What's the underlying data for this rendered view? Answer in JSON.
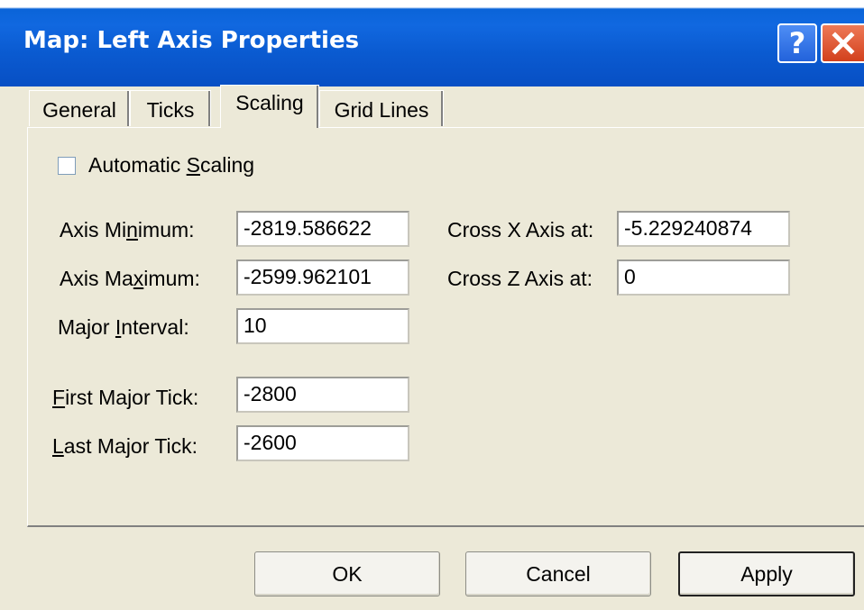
{
  "window": {
    "title": "Map: Left Axis Properties",
    "help_glyph": "?",
    "help_icon": "help-icon",
    "close_icon": "close-icon"
  },
  "tabs": [
    {
      "label": "General",
      "active": false
    },
    {
      "label": "Ticks",
      "active": false
    },
    {
      "label": "Scaling",
      "active": true
    },
    {
      "label": "Grid Lines",
      "active": false
    }
  ],
  "scaling": {
    "automatic_scaling": {
      "label_pre": "Automatic ",
      "label_accel": "S",
      "label_post": "caling",
      "checked": false
    },
    "axis_minimum": {
      "label_pre": "Axis Mi",
      "label_accel": "n",
      "label_post": "imum:",
      "value": "-2819.586622"
    },
    "axis_maximum": {
      "label_pre": "Axis Ma",
      "label_accel": "x",
      "label_post": "imum:",
      "value": "-2599.962101"
    },
    "major_interval": {
      "label_pre": "Major ",
      "label_accel": "I",
      "label_post": "nterval:",
      "value": "10"
    },
    "first_major_tick": {
      "label_pre": "",
      "label_accel": "F",
      "label_post": "irst Major Tick:",
      "value": "-2800"
    },
    "last_major_tick": {
      "label_pre": "",
      "label_accel": "L",
      "label_post": "ast Major Tick:",
      "value": "-2600"
    },
    "cross_x_axis": {
      "label": "Cross X Axis at:",
      "value": "-5.229240874"
    },
    "cross_z_axis": {
      "label": "Cross Z Axis at:",
      "value": "0"
    }
  },
  "buttons": {
    "ok": "OK",
    "cancel": "Cancel",
    "apply": "Apply"
  }
}
